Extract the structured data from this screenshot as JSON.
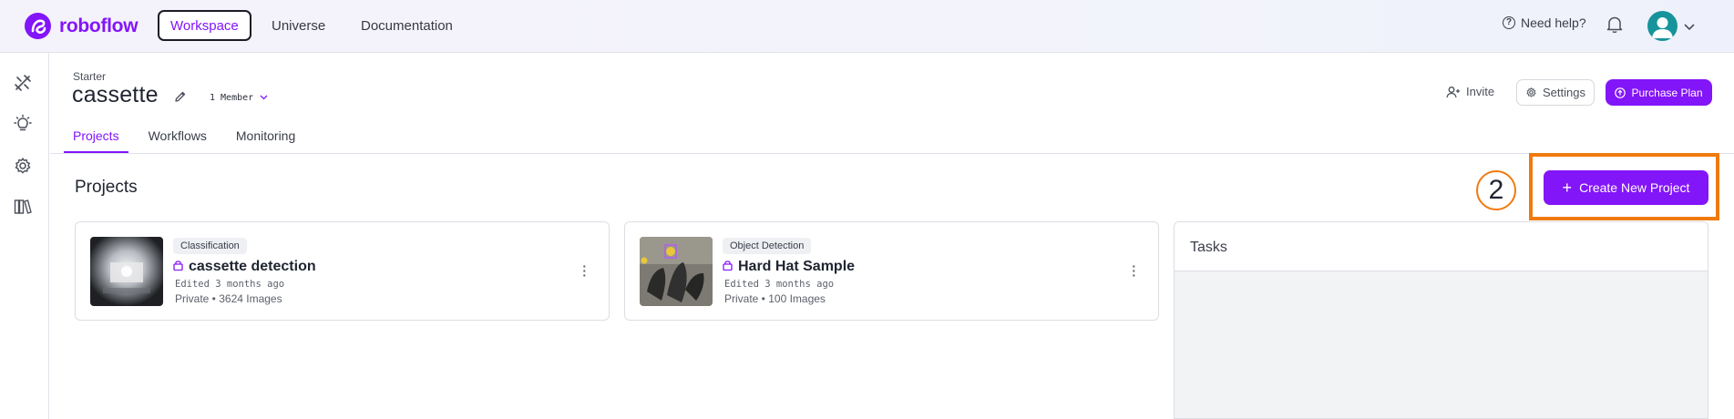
{
  "brand": {
    "name": "roboflow",
    "color": "#8315f9"
  },
  "topnav": {
    "items": [
      "Workspace",
      "Universe",
      "Documentation"
    ],
    "help": "Need help?"
  },
  "workspace": {
    "plan": "Starter",
    "name": "cassette",
    "members": "1 Member"
  },
  "actions": {
    "invite": "Invite",
    "settings": "Settings",
    "purchase": "Purchase Plan"
  },
  "tabs": [
    "Projects",
    "Workflows",
    "Monitoring"
  ],
  "main": {
    "title": "Projects",
    "step_marker": "2",
    "create_button": "Create New Project",
    "highlight_color": "#f07a0e"
  },
  "projects": [
    {
      "type": "Classification",
      "name": "cassette detection",
      "edited": "Edited 3 months ago",
      "meta": "Private • 3624 Images"
    },
    {
      "type": "Object Detection",
      "name": "Hard Hat Sample",
      "edited": "Edited 3 months ago",
      "meta": "Private • 100 Images"
    }
  ],
  "tasks": {
    "title": "Tasks"
  },
  "rail_icons": [
    "tools-icon",
    "lightbulb-icon",
    "gear-icon",
    "library-icon"
  ]
}
